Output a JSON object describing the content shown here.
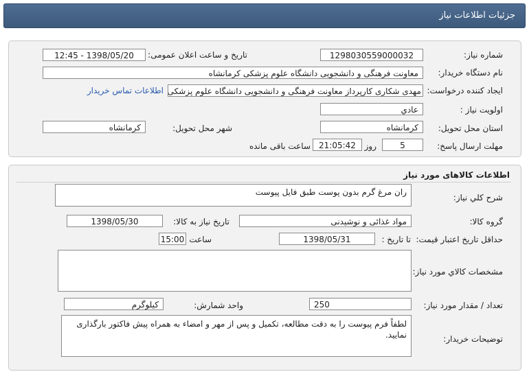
{
  "header": {
    "title": "جزئیات اطلاعات نیاز"
  },
  "details": {
    "need_number_label": "شماره نیاز:",
    "need_number": "1298030559000032",
    "announce_label": "تاریخ و ساعت اعلان عمومی:",
    "announce_value": "1398/05/20 - 12:45",
    "buyer_org_label": "نام دستگاه خریدار:",
    "buyer_org": "معاونت فرهنگی و دانشجویی دانشگاه علوم پزشکی کرمانشاه",
    "creator_label": "ایجاد کننده درخواست:",
    "creator": "مهدی شکاری کارپرداز معاونت فرهنگی و دانشجویی دانشگاه علوم پزشکی کرما",
    "contact_link": "اطلاعات تماس خریدار",
    "priority_label": "اولویت نیاز :",
    "priority": "عادي",
    "province_label": "استان محل تحویل:",
    "province": "کرمانشاه",
    "city_label": "شهر محل تحویل:",
    "city": "کرمانشاه",
    "deadline_label": "مهلت ارسال پاسخ:",
    "days": "5",
    "days_unit": "روز و",
    "time_left": "21:05:42",
    "time_left_label": "ساعت باقی مانده"
  },
  "goods": {
    "section_title": "اطلاعات کالاهای مورد نیاز",
    "summary_label": "شرح کلي نياز:",
    "summary": "ران مرغ گرم بدون پوست طبق فایل پیوست",
    "group_label": "گروه کالا:",
    "group": "مواد غذائی و نوشیدنی",
    "need_date_label": "تاریخ نیاز به کالا:",
    "need_date": "1398/05/30",
    "min_validity_label": "حداقل تاریخ اعتبار قیمت:",
    "until_date_label": "تا تاریخ :",
    "until_date": "1398/05/31",
    "time_label": "ساعت :",
    "time": "15:00",
    "specs_label": "مشخصات کالاي مورد نياز:",
    "specs": "",
    "qty_label": "تعداد / مقدار مورد نیاز:",
    "qty": "250",
    "unit_label": "واحد شمارش:",
    "unit": "کیلوگرم",
    "buyer_notes_label": "توضیحات خریدار:",
    "buyer_notes": "لطفاً فرم پیوست را به دقت مطالعه، تکمیل و پس از مهر و امضاء به همراه پیش فاکتور بارگذاری نمایید."
  },
  "colors": {
    "header": "#4a6a8f",
    "link": "#2a5db0",
    "panel": "#f2f2f2"
  }
}
